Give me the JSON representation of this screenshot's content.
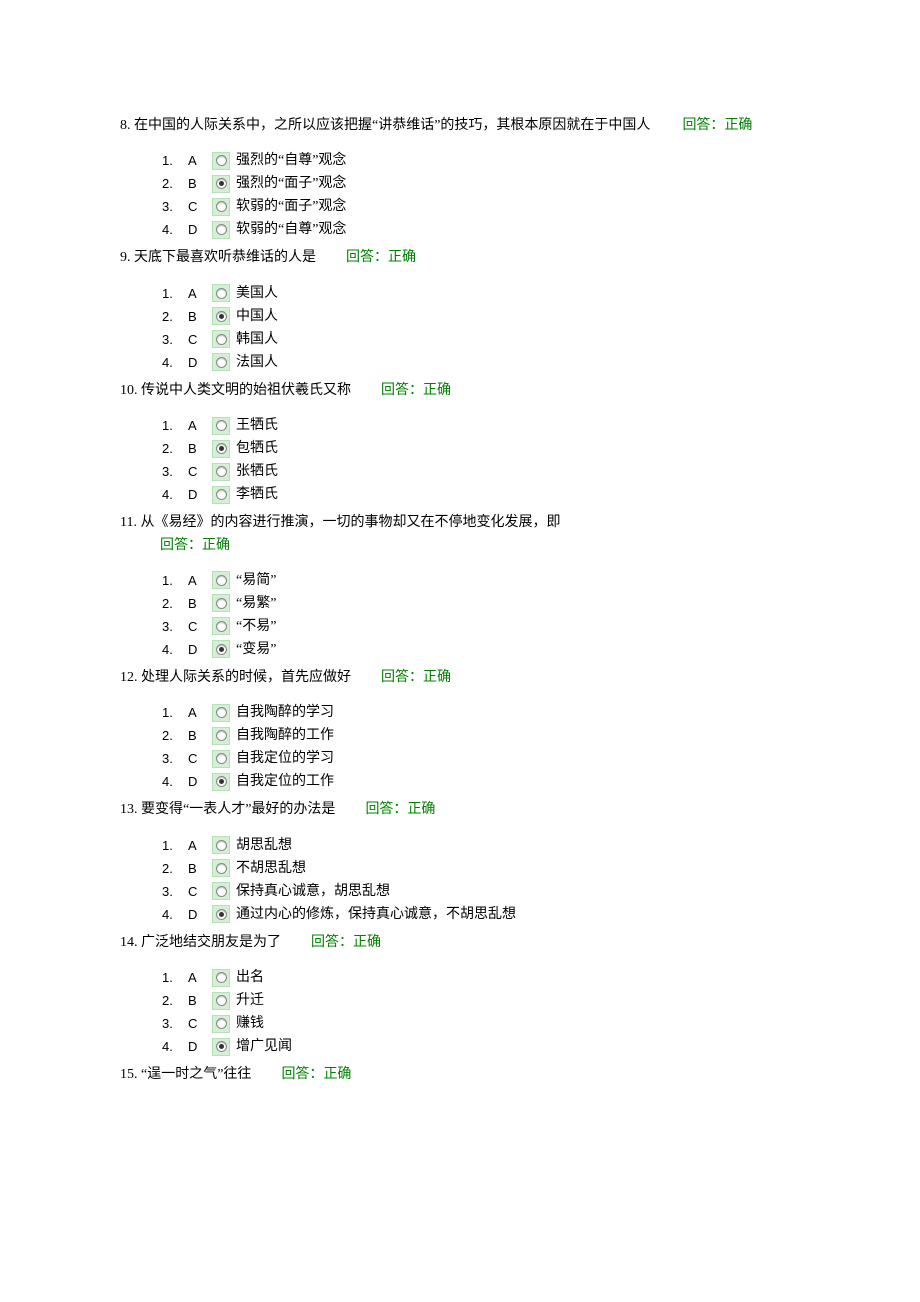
{
  "answerPrefix": "回答：",
  "answerValue": "正确",
  "questions": [
    {
      "number": "8",
      "text": "在中国的人际关系中，之所以应该把握“讲恭维话”的技巧，其根本原因就在于中国人",
      "twoLine": true,
      "selected": 1,
      "options": [
        {
          "num": "1",
          "letter": "A",
          "text": "强烈的“自尊”观念"
        },
        {
          "num": "2",
          "letter": "B",
          "text": "强烈的“面子”观念"
        },
        {
          "num": "3",
          "letter": "C",
          "text": "软弱的“面子”观念"
        },
        {
          "num": "4",
          "letter": "D",
          "text": "软弱的“自尊”观念"
        }
      ]
    },
    {
      "number": "9",
      "text": "天底下最喜欢听恭维话的人是",
      "selected": 1,
      "options": [
        {
          "num": "1",
          "letter": "A",
          "text": "美国人"
        },
        {
          "num": "2",
          "letter": "B",
          "text": "中国人"
        },
        {
          "num": "3",
          "letter": "C",
          "text": "韩国人"
        },
        {
          "num": "4",
          "letter": "D",
          "text": "法国人"
        }
      ]
    },
    {
      "number": "10",
      "text": "传说中人类文明的始祖伏羲氏又称",
      "selected": 1,
      "options": [
        {
          "num": "1",
          "letter": "A",
          "text": "王牺氏"
        },
        {
          "num": "2",
          "letter": "B",
          "text": "包牺氏"
        },
        {
          "num": "3",
          "letter": "C",
          "text": "张牺氏"
        },
        {
          "num": "4",
          "letter": "D",
          "text": "李牺氏"
        }
      ]
    },
    {
      "number": "11",
      "text": "从《易经》的内容进行推演，一切的事物却又在不停地变化发展，即",
      "answerBelow": true,
      "selected": 3,
      "options": [
        {
          "num": "1",
          "letter": "A",
          "text": "“易简”"
        },
        {
          "num": "2",
          "letter": "B",
          "text": "“易繁”"
        },
        {
          "num": "3",
          "letter": "C",
          "text": "“不易”"
        },
        {
          "num": "4",
          "letter": "D",
          "text": "“变易”"
        }
      ]
    },
    {
      "number": "12",
      "text": "处理人际关系的时候，首先应做好",
      "selected": 3,
      "options": [
        {
          "num": "1",
          "letter": "A",
          "text": "自我陶醉的学习"
        },
        {
          "num": "2",
          "letter": "B",
          "text": "自我陶醉的工作"
        },
        {
          "num": "3",
          "letter": "C",
          "text": "自我定位的学习"
        },
        {
          "num": "4",
          "letter": "D",
          "text": "自我定位的工作"
        }
      ]
    },
    {
      "number": "13",
      "text": "要变得“一表人才”最好的办法是",
      "selected": 3,
      "options": [
        {
          "num": "1",
          "letter": "A",
          "text": "胡思乱想"
        },
        {
          "num": "2",
          "letter": "B",
          "text": "不胡思乱想"
        },
        {
          "num": "3",
          "letter": "C",
          "text": "保持真心诚意，胡思乱想"
        },
        {
          "num": "4",
          "letter": "D",
          "text": "通过内心的修炼，保持真心诚意，不胡思乱想"
        }
      ]
    },
    {
      "number": "14",
      "text": "广泛地结交朋友是为了",
      "selected": 3,
      "options": [
        {
          "num": "1",
          "letter": "A",
          "text": "出名"
        },
        {
          "num": "2",
          "letter": "B",
          "text": "升迁"
        },
        {
          "num": "3",
          "letter": "C",
          "text": "赚钱"
        },
        {
          "num": "4",
          "letter": "D",
          "text": "增广见闻"
        }
      ]
    },
    {
      "number": "15",
      "text": "“逞一时之气”往往",
      "noOptions": true
    }
  ]
}
